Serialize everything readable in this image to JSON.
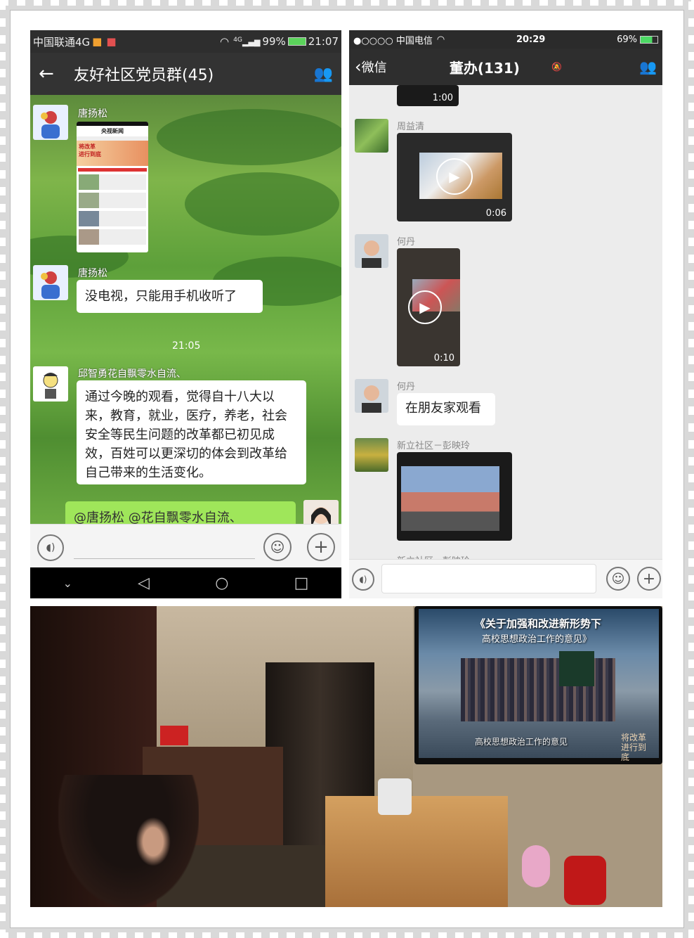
{
  "left_phone": {
    "status": {
      "carrier": "中国联通4G",
      "network": "4G",
      "battery": "99%",
      "time": "21:07"
    },
    "title": "友好社区党员群(45)",
    "messages": [
      {
        "sender": "唐扬松",
        "type": "image"
      },
      {
        "sender": "唐扬松",
        "text": "没电视，只能用手机收听了"
      },
      {
        "time": "21:05"
      },
      {
        "sender": "邱智勇花自飘零水自流、",
        "text": "通过今晚的观看，觉得自十八大以来，教育，就业，医疗，养老，社会安全等民生问题的改革都已初见成效，百姓可以更深切的体会到改革给自己带来的生活变化。"
      },
      {
        "text": "@唐扬松 @花自飘零水自流、"
      }
    ],
    "screenshot_header": "央视新闻",
    "screenshot_banner_line1": "将改革",
    "screenshot_banner_line2": "进行到底"
  },
  "right_phone": {
    "status": {
      "carrier": "●○○○○ 中国电信",
      "time": "20:29",
      "battery": "69%"
    },
    "back_label": "微信",
    "title": "董办(131)",
    "messages": [
      {
        "duration": "1:00"
      },
      {
        "sender": "周益清",
        "duration": "0:06"
      },
      {
        "sender": "何丹",
        "duration": "0:10"
      },
      {
        "sender": "何丹",
        "text": "在朋友家观看"
      },
      {
        "sender": "新立社区－彭映玲",
        "type": "image"
      },
      {
        "sender": "新立社区－彭映玲",
        "type": "partial"
      }
    ]
  },
  "photo": {
    "tv_caption_top": "《关于加强和改进新形势下",
    "tv_caption_top2": "高校思想政治工作的意见》",
    "tv_caption_bottom": "高校思想政治工作的意见",
    "tv_slogan": "将改革进行到底"
  },
  "colors": {
    "wechat_dark": "#2e2e2e",
    "bubble_green": "#9fe65a",
    "bubble_white": "#ffffff"
  }
}
